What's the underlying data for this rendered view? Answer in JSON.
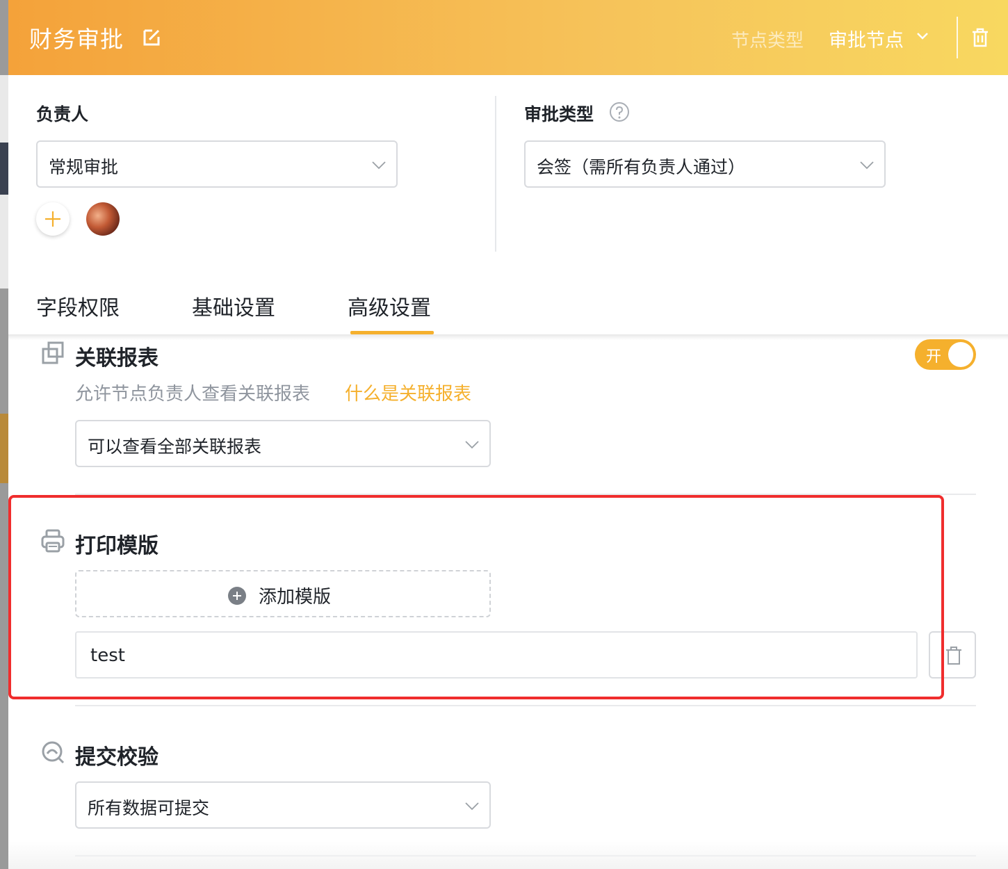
{
  "header": {
    "title": "财务审批",
    "node_type_label": "节点类型",
    "node_type_value": "审批节点"
  },
  "owner": {
    "label": "负责人",
    "select_value": "常规审批"
  },
  "approval_type": {
    "label": "审批类型",
    "select_value": "会签（需所有负责人通过）"
  },
  "tabs": [
    {
      "label": "字段权限",
      "active": false
    },
    {
      "label": "基础设置",
      "active": false
    },
    {
      "label": "高级设置",
      "active": true
    }
  ],
  "related_report": {
    "title": "关联报表",
    "toggle_label": "开",
    "toggle_on": true,
    "description": "允许节点负责人查看关联报表",
    "help_link": "什么是关联报表",
    "select_value": "可以查看全部关联报表"
  },
  "print_template": {
    "title": "打印模版",
    "add_label": "添加模版",
    "items": [
      {
        "name": "test"
      }
    ]
  },
  "submit_check": {
    "title": "提交校验",
    "select_value": "所有数据可提交"
  },
  "colors": {
    "accent": "#f5b02d",
    "header_start": "#f4a23a",
    "header_end": "#f8d860",
    "highlight": "#f02d2d"
  }
}
